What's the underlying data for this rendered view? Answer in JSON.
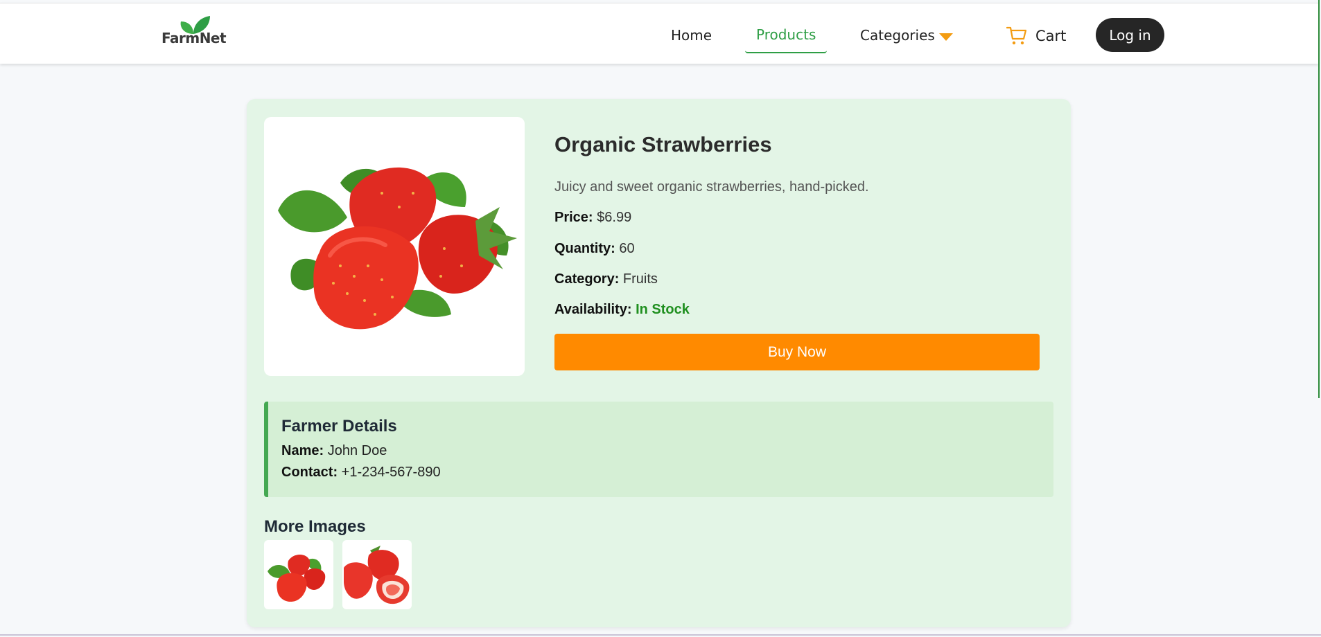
{
  "brand": {
    "name": "FarmNet",
    "accent": "#2e9e45"
  },
  "nav": {
    "home": "Home",
    "products": "Products",
    "categories": "Categories",
    "cart": "Cart",
    "login": "Log in",
    "active": "Products",
    "icons": {
      "categories": "caret-down-icon",
      "cart": "cart-icon"
    }
  },
  "product": {
    "title": "Organic Strawberries",
    "description": "Juicy and sweet organic strawberries, hand-picked.",
    "price_label": "Price:",
    "price": "$6.99",
    "quantity_label": "Quantity:",
    "quantity": "60",
    "category_label": "Category:",
    "category": "Fruits",
    "availability_label": "Availability:",
    "availability": "In Stock",
    "buy_label": "Buy Now"
  },
  "farmer": {
    "heading": "Farmer Details",
    "name_label": "Name:",
    "name": "John Doe",
    "contact_label": "Contact:",
    "contact": "+1-234-567-890"
  },
  "more_images": {
    "heading": "More Images",
    "count": 2
  },
  "colors": {
    "buy_button": "#ff8a00",
    "in_stock": "#1f8f1f",
    "card_bg": "#e3f5e6",
    "farmer_bg": "#d5efd5"
  }
}
